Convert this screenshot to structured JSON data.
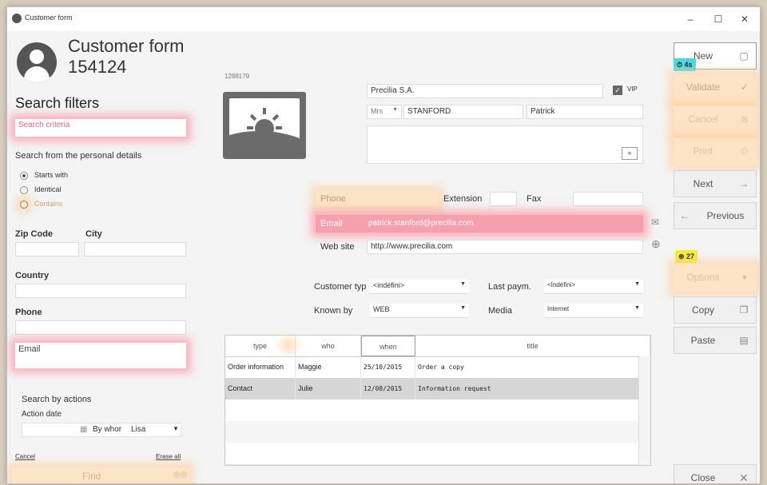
{
  "window": {
    "title": "Customer form",
    "controls": [
      "–",
      "☐",
      "✕"
    ]
  },
  "header": {
    "title": "Customer form 154124"
  },
  "left": {
    "section_title": "Search filters",
    "search_placeholder": "Search criteria",
    "personal_label": "Search from the personal details",
    "radios": [
      {
        "label": "Starts with",
        "checked": true
      },
      {
        "label": "Identical",
        "checked": false
      },
      {
        "label": "Contains",
        "checked": false
      }
    ],
    "zip_label": "Zip Code",
    "city_label": "City",
    "country_label": "Country",
    "phone_label": "Phone",
    "email_label": "Email",
    "actions_label": "Search by actions",
    "action_date_label": "Action date",
    "bywhom_label": "By whor",
    "bywhom_value": "Lisa",
    "cancel_link": "Cancel",
    "erase_link": "Erase all",
    "find_button": "Find",
    "find_icon": "binoculars-icon"
  },
  "customer": {
    "id": "1288179",
    "company": "Precilia S.A.",
    "vip_label": "VIP",
    "vip_checked": true,
    "title_value": "Mrs",
    "last_name": "STANFORD",
    "first_name": "Patrick",
    "phone_label": "Phone",
    "phone_value": "",
    "extension_label": "Extension",
    "extension_value": "",
    "fax_label": "Fax",
    "fax_value": "",
    "email_label": "Email",
    "email_value": "patrick.stanford@precilia.com",
    "website_label": "Web site",
    "website_value": "http://www.precilia.com",
    "customer_type_label": "Customer typ",
    "customer_type_value": "<indéfini>",
    "last_payment_label": "Last paym.",
    "last_payment_value": "<Indéfini>",
    "known_by_label": "Known by",
    "known_by_value": "WEB",
    "media_label": "Media",
    "media_value": "Internet"
  },
  "grid": {
    "columns": [
      "type",
      "who",
      "when",
      "title"
    ],
    "rows": [
      {
        "type": "Order information",
        "who": "Maggie",
        "when": "25/10/2015",
        "title": "Order a copy"
      },
      {
        "type": "Contact",
        "who": "Julie",
        "when": "12/08/2015",
        "title": "Information request"
      }
    ]
  },
  "actions": {
    "buttons": [
      {
        "label": "New",
        "icon": "new-page-icon",
        "glyph": "▢",
        "disabled": false
      },
      {
        "label": "Validate",
        "icon": "check-icon",
        "glyph": "✓",
        "disabled": true
      },
      {
        "label": "Cancel",
        "icon": "cancel-icon",
        "glyph": "⊗",
        "disabled": true
      },
      {
        "label": "Print",
        "icon": "print-icon",
        "glyph": "⎙",
        "disabled": true
      },
      {
        "label": "Next",
        "icon": "arrow-right-icon",
        "glyph": "→",
        "disabled": false
      },
      {
        "label": "Previous",
        "icon": "arrow-left-icon",
        "glyph": "←",
        "disabled": false
      },
      {
        "label": "Options",
        "icon": "chevron-down-icon",
        "glyph": "▾",
        "disabled": true
      },
      {
        "label": "Copy",
        "icon": "copy-icon",
        "glyph": "❐",
        "disabled": false
      },
      {
        "label": "Paste",
        "icon": "paste-icon",
        "glyph": "▤",
        "disabled": false
      }
    ],
    "close": {
      "label": "Close",
      "glyph": "✕"
    },
    "badge_timer": "4s",
    "badge_count": "27"
  }
}
